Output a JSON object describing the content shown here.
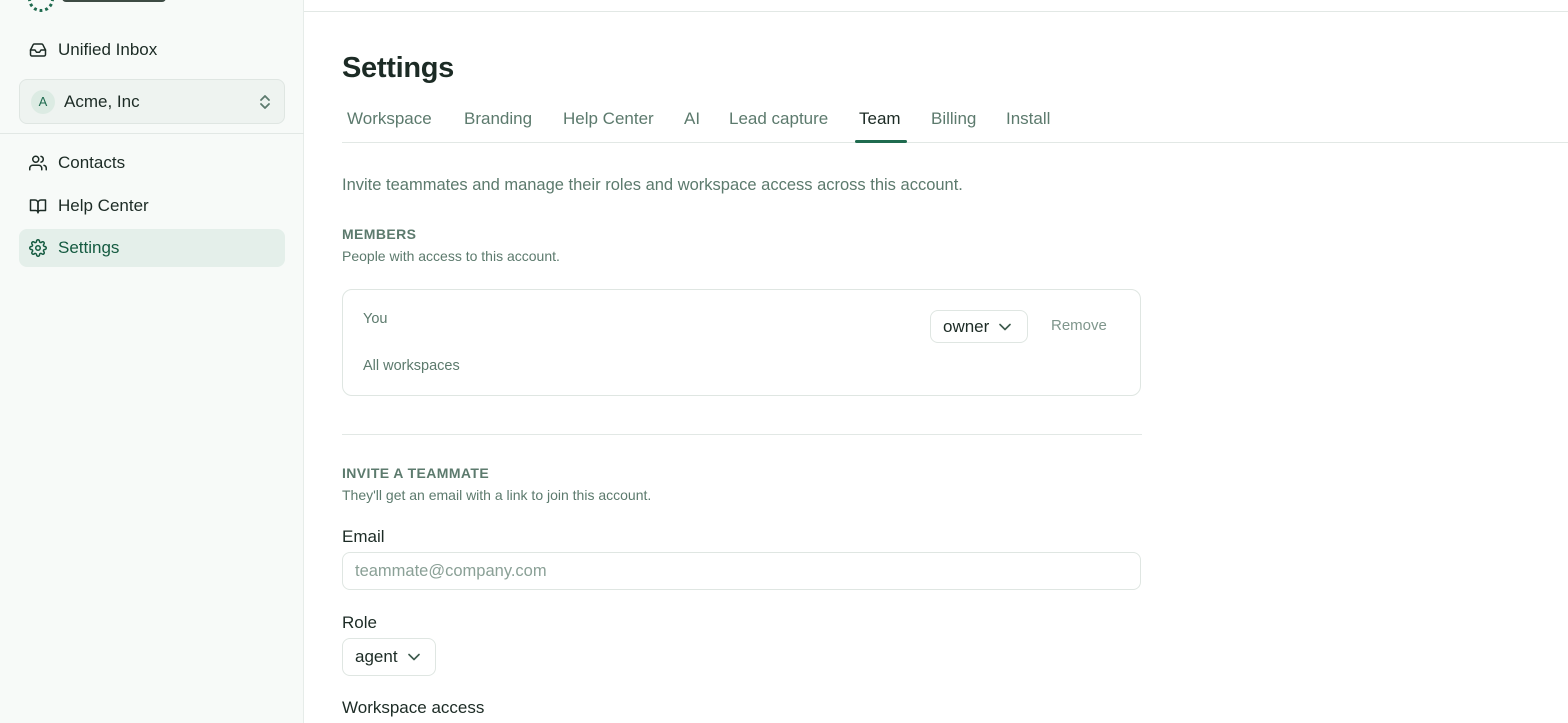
{
  "sidebar": {
    "nav_top": [
      {
        "label": "Unified Inbox",
        "icon": "inbox-icon"
      }
    ],
    "workspace": {
      "avatar": "A",
      "name": "Acme, Inc"
    },
    "nav": [
      {
        "label": "Contacts",
        "icon": "users-icon"
      },
      {
        "label": "Help Center",
        "icon": "book-icon"
      },
      {
        "label": "Settings",
        "icon": "gear-icon",
        "active": true
      }
    ]
  },
  "main": {
    "title": "Settings",
    "tabs": [
      "Workspace",
      "Branding",
      "Help Center",
      "AI",
      "Lead capture",
      "Team",
      "Billing",
      "Install"
    ],
    "active_tab": "Team",
    "intro": "Invite teammates and manage their roles and workspace access across this account.",
    "members": {
      "title": "MEMBERS",
      "subtitle": "People with access to this account.",
      "rows": [
        {
          "name": "You",
          "scope": "All workspaces",
          "role": "owner",
          "remove_label": "Remove"
        }
      ]
    },
    "invite": {
      "title": "INVITE A TEAMMATE",
      "subtitle": "They'll get an email with a link to join this account.",
      "email_label": "Email",
      "email_placeholder": "teammate@company.com",
      "role_label": "Role",
      "role_value": "agent",
      "workspace_access_label": "Workspace access"
    }
  },
  "colors": {
    "accent": "#1f6b4f",
    "muted_text": "#5c7a6d",
    "active_bg": "#e4efea"
  }
}
